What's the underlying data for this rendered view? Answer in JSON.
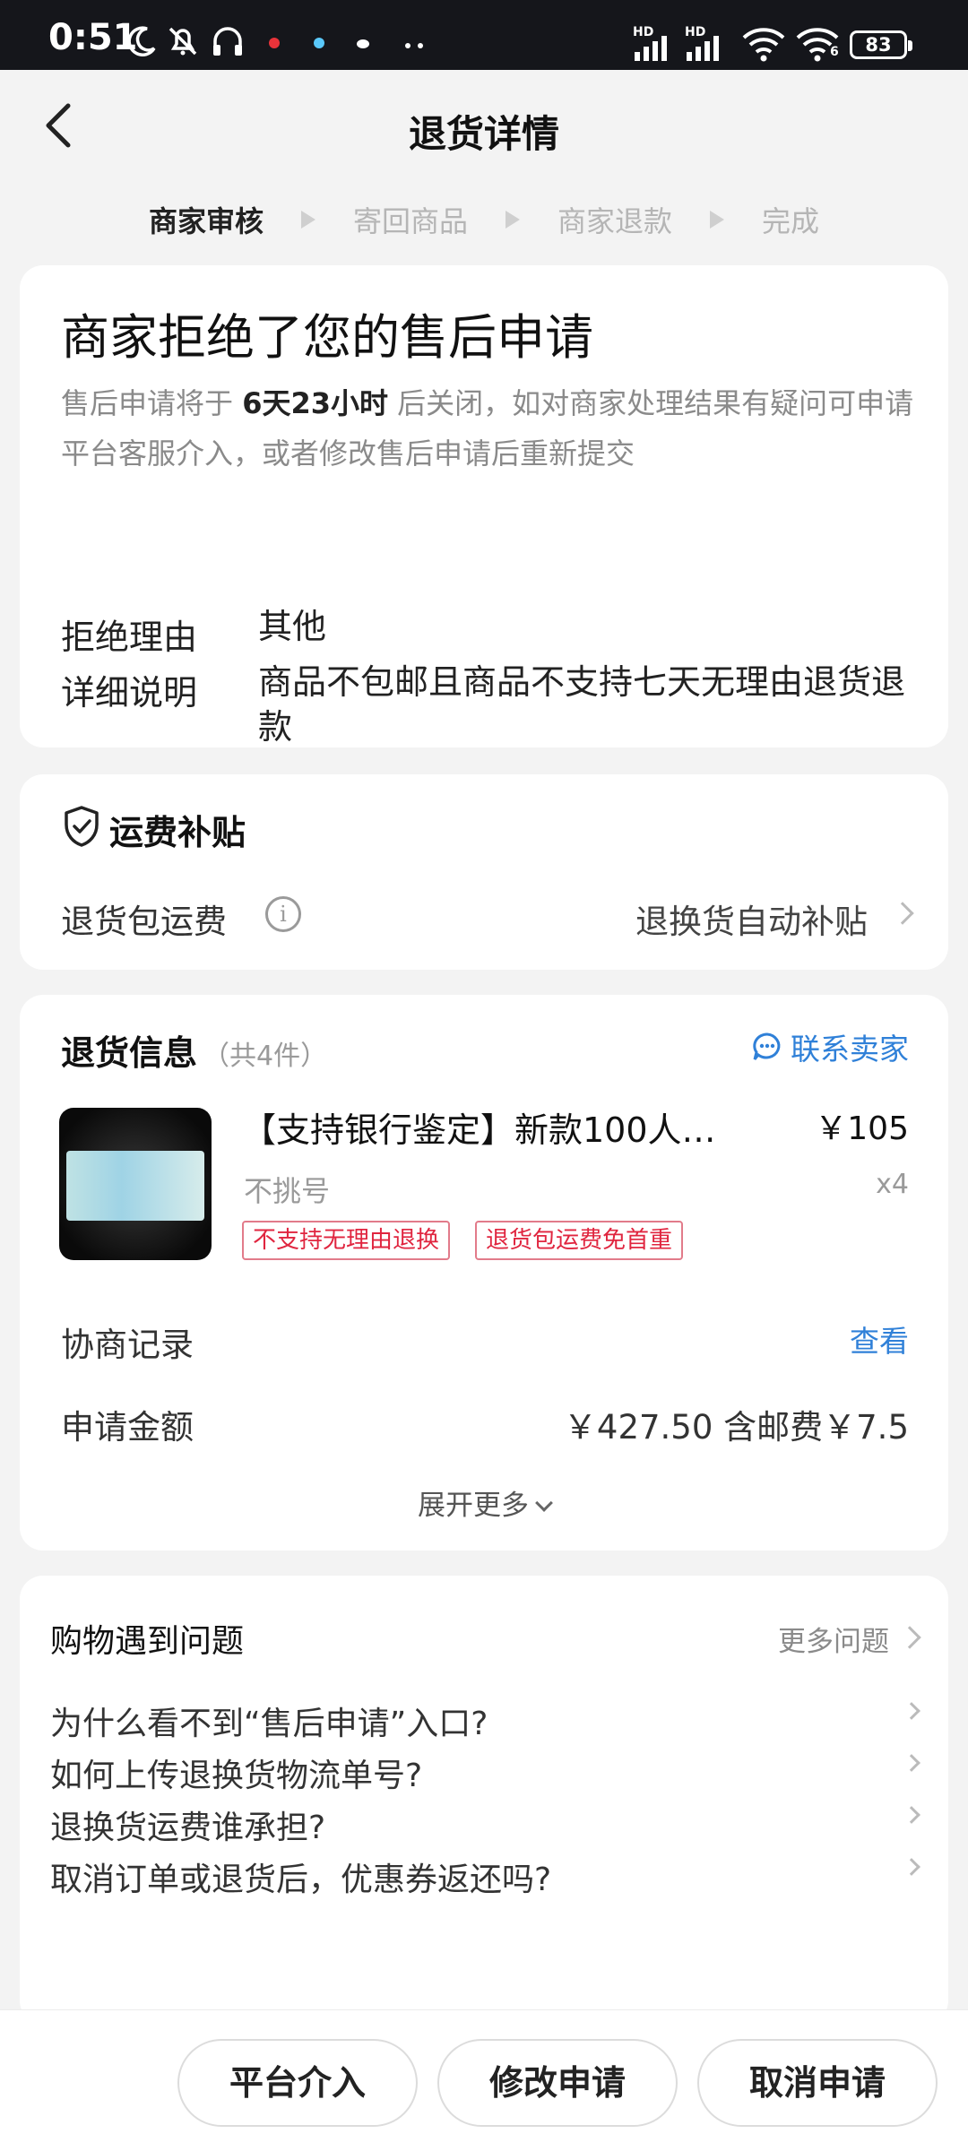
{
  "status_bar": {
    "time": "0:51",
    "network_1": "HD",
    "network_2": "HD",
    "wifi_label": "6",
    "battery": "83"
  },
  "header": {
    "title": "退货详情",
    "back_icon": "chevron-left-icon"
  },
  "steps": [
    {
      "label": "商家审核",
      "active": true
    },
    {
      "label": "寄回商品",
      "active": false
    },
    {
      "label": "商家退款",
      "active": false
    },
    {
      "label": "完成",
      "active": false
    }
  ],
  "status_card": {
    "title": "商家拒绝了您的售后申请",
    "desc_prefix": "售后申请将于",
    "desc_time": "6天23小时",
    "desc_suffix": "后关闭，如对商家处理结果有疑问可申请平台客服介入，或者修改售后申请后重新提交",
    "reason_label": "拒绝理由",
    "reason_value": "其他",
    "detail_label": "详细说明",
    "detail_value": "商品不包邮且商品不支持七天无理由退货退款"
  },
  "subsidy": {
    "title": "运费补贴",
    "label": "退货包运费",
    "value": "退换货自动补贴"
  },
  "return_info": {
    "title": "退货信息",
    "count": "（共4件）",
    "contact_label": "联系卖家",
    "product": {
      "name": "【支持银行鉴定】新款100人…",
      "price": "￥105",
      "spec": "不挑号",
      "qty": "x4",
      "tags": [
        "不支持无理由退换",
        "退货包运费免首重"
      ]
    },
    "negotiation_label": "协商记录",
    "negotiation_link": "查看",
    "amount_label": "申请金额",
    "amount_value": "￥427.50 含邮费￥7.5",
    "expand_label": "展开更多"
  },
  "faq": {
    "title": "购物遇到问题",
    "more_label": "更多问题",
    "items": [
      "为什么看不到“售后申请”入口?",
      "如何上传退换货物流单号?",
      "退换货运费谁承担?",
      "取消订单或退货后，优惠券返还吗?"
    ]
  },
  "actions": {
    "platform": "平台介入",
    "modify": "修改申请",
    "cancel": "取消申请"
  },
  "colors": {
    "accent_blue": "#2f80d8",
    "tag_red": "#e0253f",
    "status_bar_bg": "#15161b"
  }
}
